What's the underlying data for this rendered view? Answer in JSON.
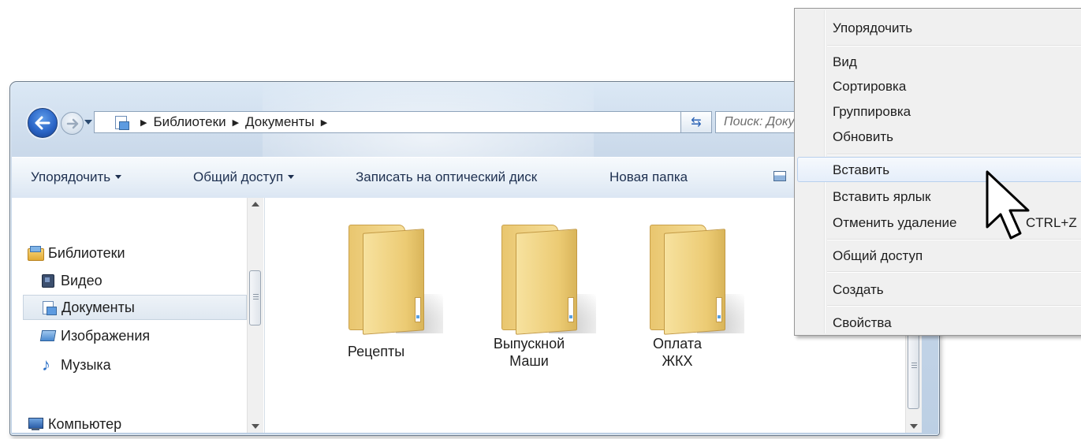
{
  "nav": {
    "crumbs": [
      "Библиотеки",
      "Документы"
    ],
    "search_placeholder": "Поиск: Документы"
  },
  "toolbar": {
    "organize": "Упорядочить",
    "share": "Общий доступ",
    "burn": "Записать на оптический диск",
    "new_folder": "Новая папка"
  },
  "sidebar": {
    "libraries": "Библиотеки",
    "video": "Видео",
    "documents": "Документы",
    "images": "Изображения",
    "music": "Музыка",
    "computer": "Компьютер"
  },
  "folders": [
    {
      "label": "Рецепты"
    },
    {
      "label": "Выпускной Маши"
    },
    {
      "label": "Оплата ЖКХ"
    }
  ],
  "context_menu": {
    "items": [
      {
        "label": "Упорядочить",
        "submenu": true
      },
      {
        "label": "Вид",
        "submenu": true
      },
      {
        "label": "Сортировка",
        "submenu": true
      },
      {
        "label": "Группировка",
        "submenu": true
      },
      {
        "label": "Обновить"
      },
      {
        "label": "Вставить",
        "highlighted": true
      },
      {
        "label": "Вставить ярлык"
      },
      {
        "label": "Отменить удаление",
        "shortcut": "CTRL+Z"
      },
      {
        "label": "Общий доступ",
        "submenu": true
      },
      {
        "label": "Создать",
        "submenu": true
      },
      {
        "label": "Свойства"
      }
    ]
  },
  "icons": {
    "back": "back-arrow-icon",
    "forward": "forward-arrow-icon",
    "refresh": "refresh-icon",
    "cursor": "mouse-pointer-icon"
  }
}
